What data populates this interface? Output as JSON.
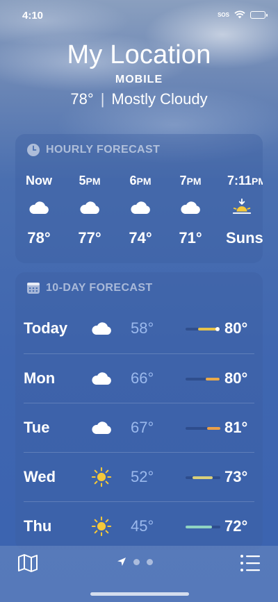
{
  "status_bar": {
    "time": "4:10",
    "sos": "SOS",
    "icons": [
      "wifi-icon",
      "battery-icon"
    ]
  },
  "header": {
    "title": "My Location",
    "subtitle": "MOBILE",
    "current_temp": "78°",
    "separator": "|",
    "condition": "Mostly Cloudy"
  },
  "hourly": {
    "title": "HOURLY FORECAST",
    "icon": "clock-icon",
    "items": [
      {
        "label": "Now",
        "ampm": "",
        "icon": "cloud-icon",
        "temp": "78°"
      },
      {
        "label": "5",
        "ampm": "PM",
        "icon": "cloud-icon",
        "temp": "77°"
      },
      {
        "label": "6",
        "ampm": "PM",
        "icon": "cloud-icon",
        "temp": "74°"
      },
      {
        "label": "7",
        "ampm": "PM",
        "icon": "cloud-icon",
        "temp": "71°"
      },
      {
        "label": "7:11",
        "ampm": "PM",
        "icon": "sunset-icon",
        "temp": "Sunset"
      }
    ]
  },
  "daily": {
    "title": "10-DAY FORECAST",
    "icon": "calendar-icon",
    "range_min": 45,
    "range_max": 81,
    "items": [
      {
        "day": "Today",
        "icon": "cloud-icon",
        "low": "58°",
        "high": "80°",
        "low_value": 58,
        "high_value": 80,
        "current_value": 78,
        "bar_color": "#e6c24a"
      },
      {
        "day": "Mon",
        "icon": "cloud-icon",
        "low": "66°",
        "high": "80°",
        "low_value": 66,
        "high_value": 80,
        "bar_color": "#e9a94a"
      },
      {
        "day": "Tue",
        "icon": "cloud-icon",
        "low": "67°",
        "high": "81°",
        "low_value": 67,
        "high_value": 81,
        "bar_color": "#eb9f48"
      },
      {
        "day": "Wed",
        "icon": "sun-icon",
        "low": "52°",
        "high": "73°",
        "low_value": 52,
        "high_value": 73,
        "bar_color": "#d9cf7a"
      },
      {
        "day": "Thu",
        "icon": "sun-icon",
        "low": "45°",
        "high": "72°",
        "low_value": 45,
        "high_value": 72,
        "bar_color": "#8fd3c2"
      }
    ]
  },
  "bottom_bar": {
    "map_icon": "map-icon",
    "location_icon": "location-arrow-icon",
    "list_icon": "list-icon",
    "page_count": 3
  },
  "colors": {
    "accent_low_temp": "#a0bef0",
    "sun": "#f5c83a"
  }
}
